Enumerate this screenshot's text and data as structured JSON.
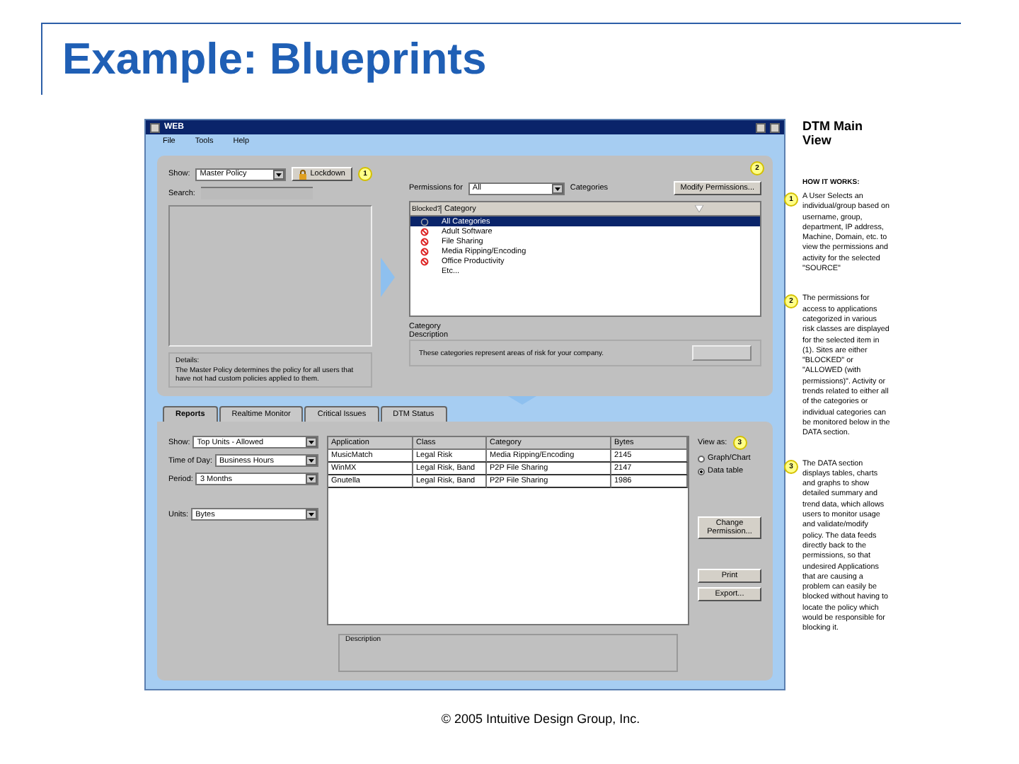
{
  "slide": {
    "title": "Example: Blueprints",
    "footer": "© 2005 Intuitive Design Group, Inc."
  },
  "window": {
    "title": "WEB",
    "menu": [
      "File",
      "Tools",
      "Help"
    ]
  },
  "policy": {
    "show_label": "Show:",
    "show_value": "Master Policy",
    "lockdown": "Lockdown",
    "marker": "1",
    "search_label": "Search:",
    "details_label": "Details:",
    "details_text": "The Master Policy determines the policy for all users that have not had custom policies applied to them."
  },
  "permissions": {
    "marker": "2",
    "label": "Permissions for",
    "value": "All",
    "categories_label": "Categories",
    "modify_button": "Modify Permissions...",
    "columns": [
      "Blocked?",
      "Category"
    ],
    "rows": [
      {
        "kind": "neutral",
        "category": "All Categories",
        "selected": true
      },
      {
        "kind": "blocked",
        "category": "Adult Software",
        "selected": false
      },
      {
        "kind": "blocked",
        "category": "File Sharing",
        "selected": false
      },
      {
        "kind": "blocked",
        "category": "Media Ripping/Encoding",
        "selected": false
      },
      {
        "kind": "blocked",
        "category": "Office Productivity",
        "selected": false
      },
      {
        "kind": "plain",
        "category": "Etc...",
        "selected": false
      }
    ],
    "description_label": "Category Description",
    "description_text": "These categories represent areas of risk for your company."
  },
  "tabs": [
    {
      "label": "Reports",
      "selected": true
    },
    {
      "label": "Realtime Monitor",
      "selected": false
    },
    {
      "label": "Critical Issues",
      "selected": false
    },
    {
      "label": "DTM Status",
      "selected": false
    }
  ],
  "filters": [
    {
      "label": "Show:",
      "value": "Top Units - Allowed"
    },
    {
      "label": "Time of Day:",
      "value": "Business Hours"
    },
    {
      "label": "Period:",
      "value": "3 Months"
    },
    {
      "label": "Units:",
      "value": "Bytes"
    }
  ],
  "report_table": {
    "columns": [
      "Application",
      "Class",
      "Category",
      "Bytes"
    ],
    "rows": [
      [
        "MusicMatch",
        "Legal Risk",
        "Media Ripping/Encoding",
        "2145"
      ],
      [
        "WinMX",
        "Legal Risk, Band",
        "P2P File Sharing",
        "2147"
      ],
      [
        "Gnutella",
        "Legal Risk, Band",
        "P2P File Sharing",
        "1986"
      ]
    ],
    "description_label": "Description"
  },
  "view_as": {
    "label": "View as:",
    "marker": "3",
    "options": [
      {
        "label": "Graph/Chart",
        "selected": false
      },
      {
        "label": "Data table",
        "selected": true
      }
    ]
  },
  "actions": [
    "Change Permission...",
    "Print",
    "Export..."
  ],
  "notes": {
    "title": "DTM Main View",
    "subtitle": "HOW IT WORKS:",
    "items": [
      {
        "marker": "1",
        "text": "A User Selects an individual/group based on username, group, department, IP address, Machine, Domain, etc. to view the permissions and activity for the selected \"SOURCE\""
      },
      {
        "marker": "2",
        "text": "The permissions for access to applications categorized in various risk classes are displayed for the selected item in (1). Sites are either \"BLOCKED\" or \"ALLOWED (with permissions)\". Activity or trends related to either all of the categories or individual categories can be monitored below in the DATA section."
      },
      {
        "marker": "3",
        "text": "The DATA section displays tables, charts and graphs to show detailed summary and trend data, which allows users to monitor usage and validate/modify policy. The data feeds directly back to the permissions, so that undesired Applications that are causing a problem can easily be blocked without having to locate the policy which would be responsible for blocking it."
      }
    ]
  }
}
